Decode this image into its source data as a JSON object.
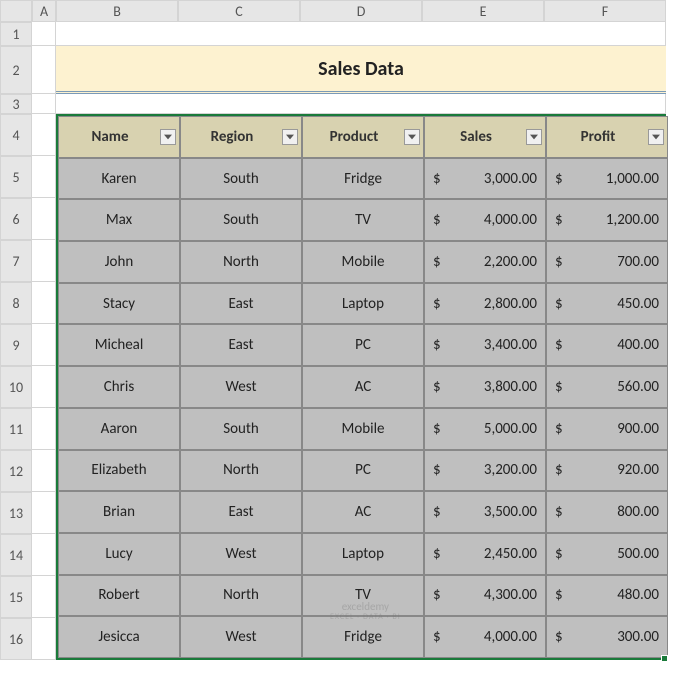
{
  "columns": [
    "",
    "A",
    "B",
    "C",
    "D",
    "E",
    "F"
  ],
  "rows": [
    "1",
    "2",
    "3",
    "4",
    "5",
    "6",
    "7",
    "8",
    "9",
    "10",
    "11",
    "12",
    "13",
    "14",
    "15",
    "16"
  ],
  "title": "Sales Data",
  "headers": [
    "Name",
    "Region",
    "Product",
    "Sales",
    "Profit"
  ],
  "data": [
    {
      "name": "Karen",
      "region": "South",
      "product": "Fridge",
      "sales": "3,000.00",
      "profit": "1,000.00"
    },
    {
      "name": "Max",
      "region": "South",
      "product": "TV",
      "sales": "4,000.00",
      "profit": "1,200.00"
    },
    {
      "name": "John",
      "region": "North",
      "product": "Mobile",
      "sales": "2,200.00",
      "profit": "700.00"
    },
    {
      "name": "Stacy",
      "region": "East",
      "product": "Laptop",
      "sales": "2,800.00",
      "profit": "450.00"
    },
    {
      "name": "Micheal",
      "region": "East",
      "product": "PC",
      "sales": "3,400.00",
      "profit": "400.00"
    },
    {
      "name": "Chris",
      "region": "West",
      "product": "AC",
      "sales": "3,800.00",
      "profit": "560.00"
    },
    {
      "name": "Aaron",
      "region": "South",
      "product": "Mobile",
      "sales": "5,000.00",
      "profit": "900.00"
    },
    {
      "name": "Elizabeth",
      "region": "North",
      "product": "PC",
      "sales": "3,200.00",
      "profit": "920.00"
    },
    {
      "name": "Brian",
      "region": "East",
      "product": "AC",
      "sales": "3,500.00",
      "profit": "800.00"
    },
    {
      "name": "Lucy",
      "region": "West",
      "product": "Laptop",
      "sales": "2,450.00",
      "profit": "500.00"
    },
    {
      "name": "Robert",
      "region": "North",
      "product": "TV",
      "sales": "4,300.00",
      "profit": "480.00"
    },
    {
      "name": "Jesicca",
      "region": "West",
      "product": "Fridge",
      "sales": "4,000.00",
      "profit": "300.00"
    }
  ],
  "currency": "$",
  "watermark": {
    "line1": "exceldemy",
    "line2": "EXCEL · DATA · BI"
  }
}
